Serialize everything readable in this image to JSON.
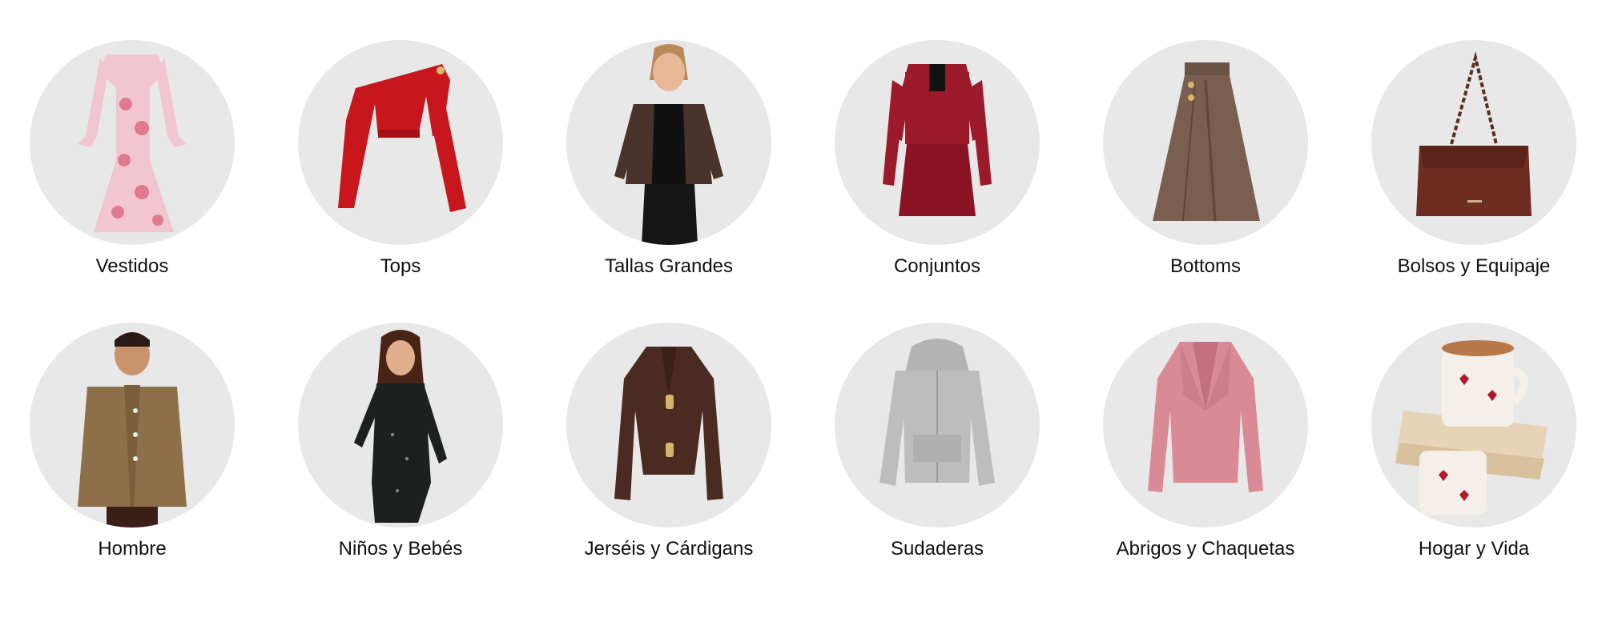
{
  "categories": [
    {
      "label": "Vestidos",
      "icon": "floral-dress-icon"
    },
    {
      "label": "Tops",
      "icon": "red-top-icon"
    },
    {
      "label": "Tallas Grandes",
      "icon": "plus-size-model-icon"
    },
    {
      "label": "Conjuntos",
      "icon": "tweed-set-icon"
    },
    {
      "label": "Bottoms",
      "icon": "skirt-icon"
    },
    {
      "label": "Bolsos y Equipaje",
      "icon": "handbag-icon"
    },
    {
      "label": "Hombre",
      "icon": "mens-cardigan-icon"
    },
    {
      "label": "Niños y Bebés",
      "icon": "girl-dress-icon"
    },
    {
      "label": "Jerséis y Cárdigans",
      "icon": "knit-cardigan-icon"
    },
    {
      "label": "Sudaderas",
      "icon": "hoodie-icon"
    },
    {
      "label": "Abrigos y Chaquetas",
      "icon": "pink-jacket-icon"
    },
    {
      "label": "Hogar y Vida",
      "icon": "mug-books-icon"
    }
  ],
  "colors": {
    "circle_bg": "#e8e8e8",
    "label_text": "#111111"
  }
}
